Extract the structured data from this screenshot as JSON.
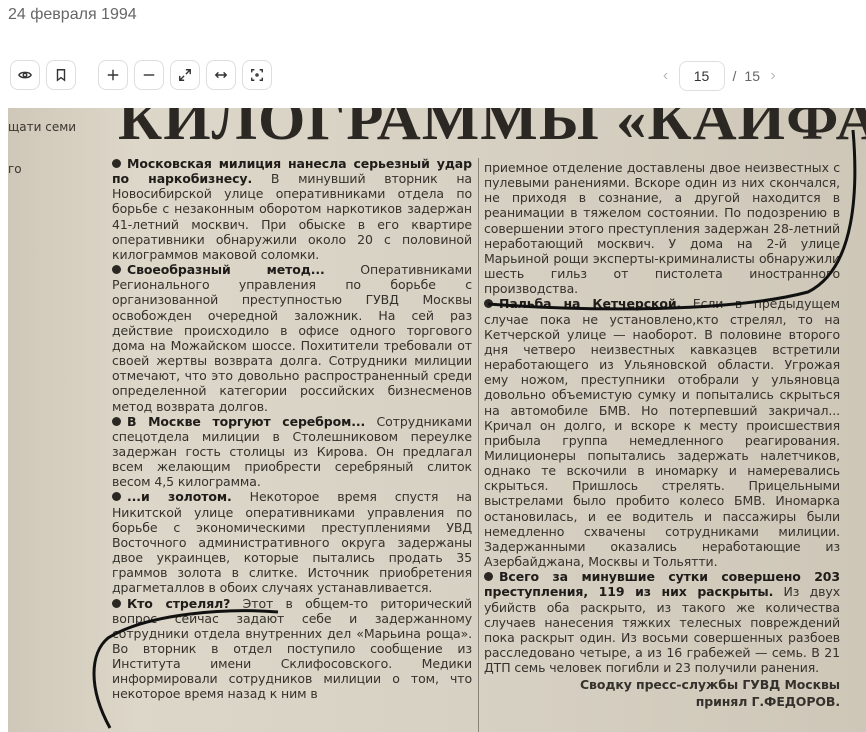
{
  "header": {
    "date": "24 февраля 1994"
  },
  "toolbar": {
    "buttons": [
      {
        "name": "view-button",
        "icon": "eye-icon"
      },
      {
        "name": "bookmark-button",
        "icon": "bookmark-icon"
      },
      {
        "name": "zoom-in-button",
        "icon": "plus-icon"
      },
      {
        "name": "zoom-out-button",
        "icon": "minus-icon"
      },
      {
        "name": "fullscreen-button",
        "icon": "expand-icon"
      },
      {
        "name": "fit-width-button",
        "icon": "fit-width-icon"
      },
      {
        "name": "fit-page-button",
        "icon": "fit-page-icon"
      }
    ]
  },
  "pager": {
    "current": "15",
    "separator": "/",
    "total": "15",
    "prev": "‹",
    "next": "›"
  },
  "scan": {
    "headline": "КИЛОГРАММЫ «КАЙФА»",
    "margin_text": [
      "щати семи",
      "го"
    ],
    "col1": [
      {
        "lead": "Московская милиция нанесла серьезный удар по наркобизнесу.",
        "text": " В минувший вторник на Новосибирской улице оперативниками отдела по борьбе с незаконным оборотом наркотиков задержан 41-летний москвич. При обыске в его квартире оперативники обнаружили около 20 с половиной килограммов маковой соломки."
      },
      {
        "lead": "Своеобразный метод...",
        "text": " Оперативниками Регионального управления по борьбе с организованной преступностью ГУВД Москвы освобожден очередной заложник. На сей раз действие происходило в офисе одного торгового дома на Можайском шоссе. Похитители требовали от своей жертвы возврата долга. Сотрудники милиции отмечают, что это довольно распространенный среди определенной категории российских бизнесменов метод возврата долгов."
      },
      {
        "lead": "В Москве торгуют серебром...",
        "text": " Сотрудниками спецотдела милиции в Столешниковом переулке задержан гость столицы из Кирова. Он предлагал всем желающим приобрести серебряный слиток весом 4,5 килограмма."
      },
      {
        "lead": "...и золотом.",
        "text": " Некоторое время спустя на Никитской улице оперативниками управления по борьбе с экономическими преступлениями УВД Восточного административного округа задержаны двое украинцев, которые пытались продать 35 граммов золота в слитке. Источник приобретения драгметаллов в обоих случаях устанавливается."
      },
      {
        "lead": "Кто стрелял?",
        "text": " Этот в общем-то риторический вопрос сейчас задают себе и задержанному сотрудники отдела внутренних дел «Марьина роща». Во вторник в отдел поступило сообщение из Института имени Склифосовского. Медики информировали сотрудников милиции о том, что некоторое время назад к ним в"
      }
    ],
    "col2": [
      {
        "lead": "",
        "text": "приемное отделение доставлены двое неизвестных с пулевыми ранениями. Вскоре один из них скончался, не приходя в сознание, а другой находится в реанимации в тяжелом состоянии. По подозрению в совершении этого преступления задержан 28-летний неработающий москвич. У дома на 2-й улице Марьиной рощи эксперты-криминалисты обнаружили шесть гильз от пистолета иностранного производства."
      },
      {
        "lead": "Пальба на Кетчерской.",
        "text": " Если в предыдущем случае пока не установлено,кто стрелял, то на Кетчерской улице — наоборот. В половине второго дня четверо неизвестных кавказцев встретили неработающего из Ульяновской области. Угрожая ему ножом, преступники отобрали у ульяновца довольно объемистую сумку и попытались скрыться на автомобиле БМВ. Но потерпевший закричал... Кричал он долго, и вскоре к месту происшествия прибыла группа немедленного реагирования. Милиционеры попытались задержать налетчиков, однако те вскочили в иномарку и намеревались скрыться. Пришлось стрелять. Прицельными выстрелами было пробито колесо БМВ. Иномарка остановилась, и ее водитель и пассажиры были немедленно схвачены сотрудниками милиции. Задержанными оказались неработающие из Азербайджана, Москвы и Тольятти."
      },
      {
        "lead": "Всего за минувшие сутки совершено 203 преступления, 119 из них раскрыты.",
        "text": " Из двух убийств оба раскрыто, из такого же количества случаев нанесения тяжких телесных повреждений пока раскрыт один. Из восьми совершенных разбоев расследовано четыре, а из 16 грабежей — семь. В 21 ДТП семь человек погибли и 23 получили ранения."
      }
    ],
    "signature": [
      "Сводку пресс-службы ГУВД Москвы",
      "принял Г.ФЕДОРОВ."
    ]
  }
}
